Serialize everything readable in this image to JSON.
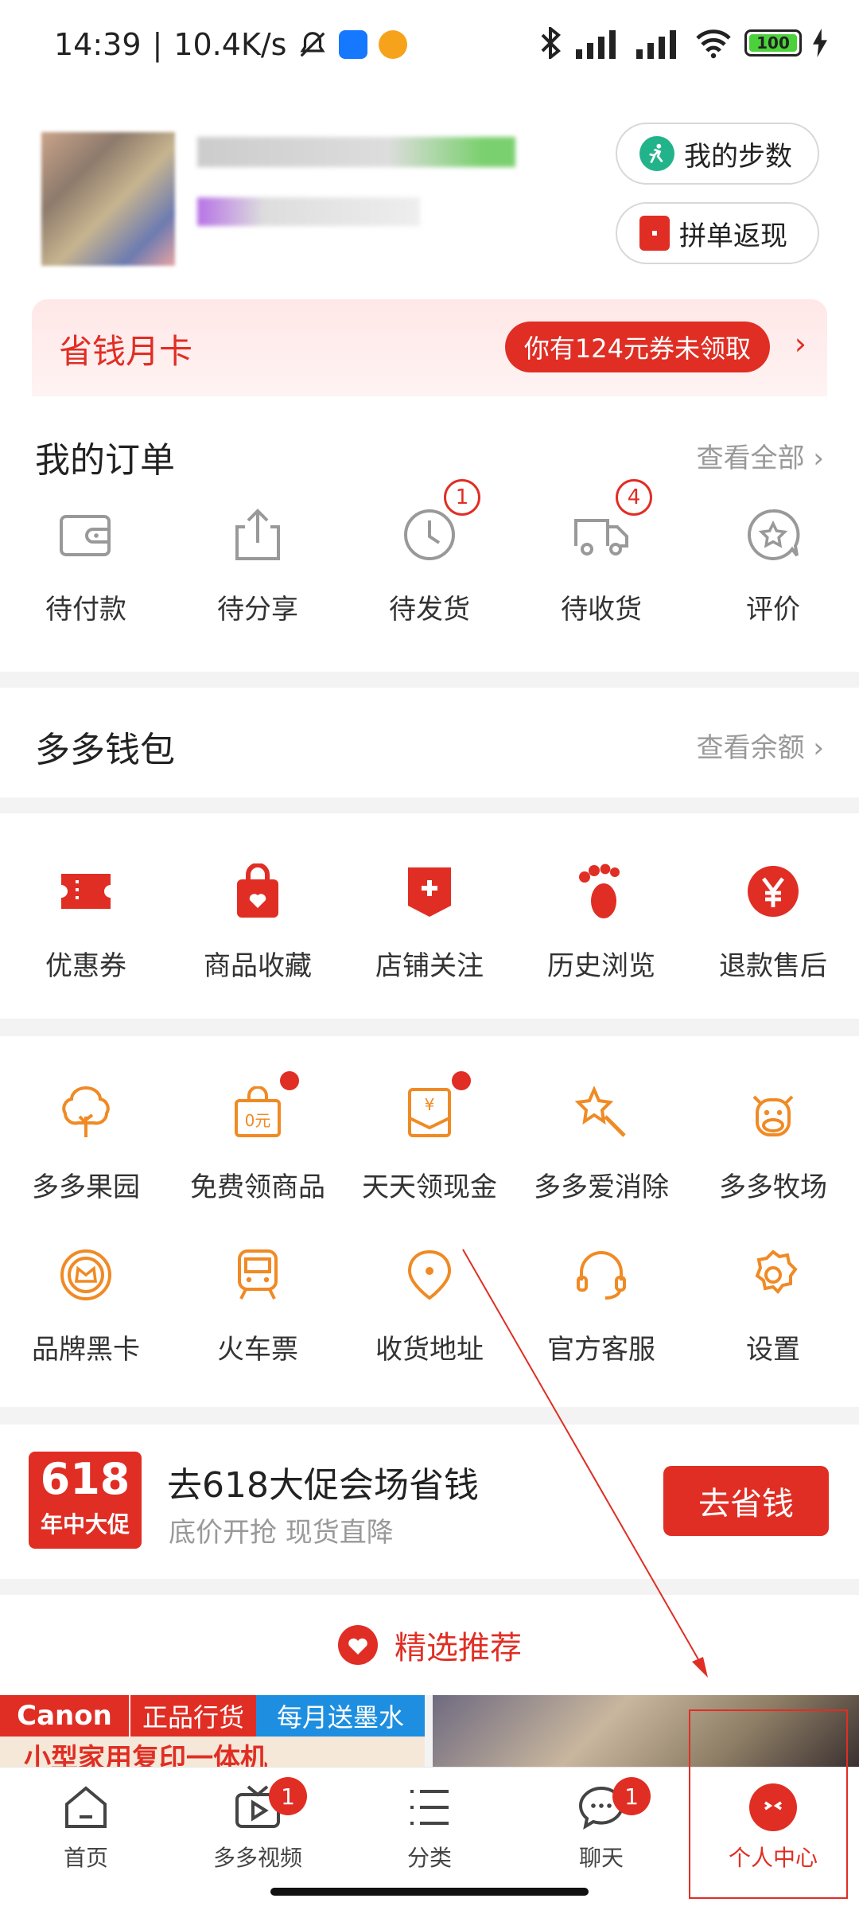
{
  "status_bar": {
    "time": "14:39",
    "speed": "10.4K/s",
    "battery": "100"
  },
  "profile": {
    "steps_button": "我的步数",
    "group_button": "拼单返现",
    "save_card_title": "省钱月卡",
    "save_card_badge": "你有124元券未领取"
  },
  "orders": {
    "title": "我的订单",
    "view_all": "查看全部",
    "items": [
      {
        "label": "待付款",
        "icon": "wallet-icon"
      },
      {
        "label": "待分享",
        "icon": "share-icon"
      },
      {
        "label": "待发货",
        "icon": "clock-icon",
        "badge": "1"
      },
      {
        "label": "待收货",
        "icon": "truck-icon",
        "badge": "4"
      },
      {
        "label": "评价",
        "icon": "review-icon"
      }
    ]
  },
  "wallet": {
    "title": "多多钱包",
    "view_balance": "查看余额"
  },
  "quick": {
    "items": [
      {
        "label": "优惠券",
        "icon": "coupon-icon"
      },
      {
        "label": "商品收藏",
        "icon": "favorite-bag-icon"
      },
      {
        "label": "店铺关注",
        "icon": "store-follow-icon"
      },
      {
        "label": "历史浏览",
        "icon": "footprint-icon"
      },
      {
        "label": "退款售后",
        "icon": "refund-icon"
      }
    ]
  },
  "services": {
    "row1": [
      {
        "label": "多多果园",
        "icon": "tree-icon"
      },
      {
        "label": "免费领商品",
        "icon": "free-bag-icon",
        "dot": true
      },
      {
        "label": "天天领现金",
        "icon": "cash-envelope-icon",
        "dot": true
      },
      {
        "label": "多多爱消除",
        "icon": "star-wand-icon"
      },
      {
        "label": "多多牧场",
        "icon": "cow-icon"
      }
    ],
    "row2": [
      {
        "label": "品牌黑卡",
        "icon": "crown-badge-icon"
      },
      {
        "label": "火车票",
        "icon": "train-icon"
      },
      {
        "label": "收货地址",
        "icon": "location-pin-icon"
      },
      {
        "label": "官方客服",
        "icon": "headset-icon"
      },
      {
        "label": "设置",
        "icon": "gear-icon"
      }
    ]
  },
  "promo": {
    "logo_big": "618",
    "logo_small": "年中大促",
    "title": "去618大促会场省钱",
    "subtitle": "底价开抢 现货直降",
    "button": "去省钱"
  },
  "recommend": {
    "label": "精选推荐"
  },
  "product_preview": {
    "brand": "Canon",
    "tag1": "正品行货",
    "tag2": "每月送墨水",
    "bottom_text": "小型家用复印一体机"
  },
  "nav": {
    "items": [
      {
        "label": "首页",
        "icon": "home-icon"
      },
      {
        "label": "多多视频",
        "icon": "video-icon",
        "badge": "1"
      },
      {
        "label": "分类",
        "icon": "category-icon"
      },
      {
        "label": "聊天",
        "icon": "chat-icon",
        "badge": "1"
      },
      {
        "label": "个人中心",
        "icon": "profile-center-icon",
        "active": true
      }
    ]
  },
  "colors": {
    "brand_red": "#e02e24",
    "service_orange": "#f08a24"
  }
}
